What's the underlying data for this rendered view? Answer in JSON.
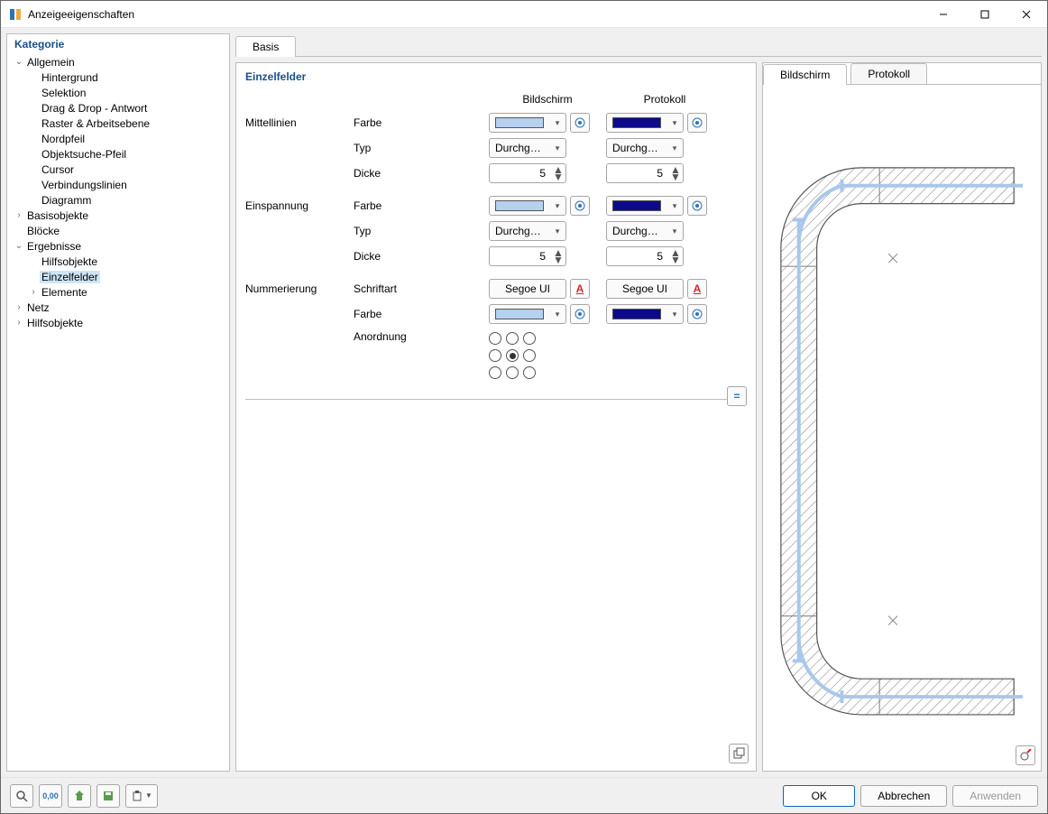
{
  "window": {
    "title": "Anzeigeeigenschaften"
  },
  "sidebar": {
    "title": "Kategorie",
    "items": [
      {
        "label": "Allgemein",
        "depth": 0,
        "twisty": "v"
      },
      {
        "label": "Hintergrund",
        "depth": 1,
        "twisty": ""
      },
      {
        "label": "Selektion",
        "depth": 1,
        "twisty": ""
      },
      {
        "label": "Drag & Drop - Antwort",
        "depth": 1,
        "twisty": ""
      },
      {
        "label": "Raster & Arbeitsebene",
        "depth": 1,
        "twisty": ""
      },
      {
        "label": "Nordpfeil",
        "depth": 1,
        "twisty": ""
      },
      {
        "label": "Objektsuche-Pfeil",
        "depth": 1,
        "twisty": ""
      },
      {
        "label": "Cursor",
        "depth": 1,
        "twisty": ""
      },
      {
        "label": "Verbindungslinien",
        "depth": 1,
        "twisty": ""
      },
      {
        "label": "Diagramm",
        "depth": 1,
        "twisty": ""
      },
      {
        "label": "Basisobjekte",
        "depth": 0,
        "twisty": ">"
      },
      {
        "label": "Blöcke",
        "depth": 0,
        "twisty": ""
      },
      {
        "label": "Ergebnisse",
        "depth": 0,
        "twisty": "v"
      },
      {
        "label": "Hilfsobjekte",
        "depth": 1,
        "twisty": ""
      },
      {
        "label": "Einzelfelder",
        "depth": 1,
        "twisty": "",
        "selected": true
      },
      {
        "label": "Elemente",
        "depth": 1,
        "twisty": ">"
      },
      {
        "label": "Netz",
        "depth": 0,
        "twisty": ">"
      },
      {
        "label": "Hilfsobjekte",
        "depth": 0,
        "twisty": ">"
      }
    ]
  },
  "main": {
    "tab": "Basis",
    "section_title": "Einzelfelder",
    "col_screen": "Bildschirm",
    "col_proto": "Protokoll",
    "groups": {
      "mittellinien": {
        "label": "Mittellinien",
        "farbe_label": "Farbe",
        "typ_label": "Typ",
        "dicke_label": "Dicke",
        "screen": {
          "color": "#b6d0f0",
          "type": "Durchgezo...",
          "thickness": "5"
        },
        "proto": {
          "color": "#0b0b8a",
          "type": "Durchgezo...",
          "thickness": "5"
        }
      },
      "einspannung": {
        "label": "Einspannung",
        "farbe_label": "Farbe",
        "typ_label": "Typ",
        "dicke_label": "Dicke",
        "screen": {
          "color": "#b6d0f0",
          "type": "Durchgezo...",
          "thickness": "5"
        },
        "proto": {
          "color": "#0b0b8a",
          "type": "Durchgezo...",
          "thickness": "5"
        }
      },
      "nummerierung": {
        "label": "Nummerierung",
        "schriftart_label": "Schriftart",
        "farbe_label": "Farbe",
        "anordnung_label": "Anordnung",
        "screen": {
          "font": "Segoe UI",
          "color": "#b6d0f0"
        },
        "proto": {
          "font": "Segoe UI",
          "color": "#0b0b8a"
        },
        "anordnung_selected": 4
      }
    }
  },
  "preview": {
    "tab_screen": "Bildschirm",
    "tab_proto": "Protokoll"
  },
  "footer": {
    "ok": "OK",
    "cancel": "Abbrechen",
    "apply": "Anwenden"
  }
}
